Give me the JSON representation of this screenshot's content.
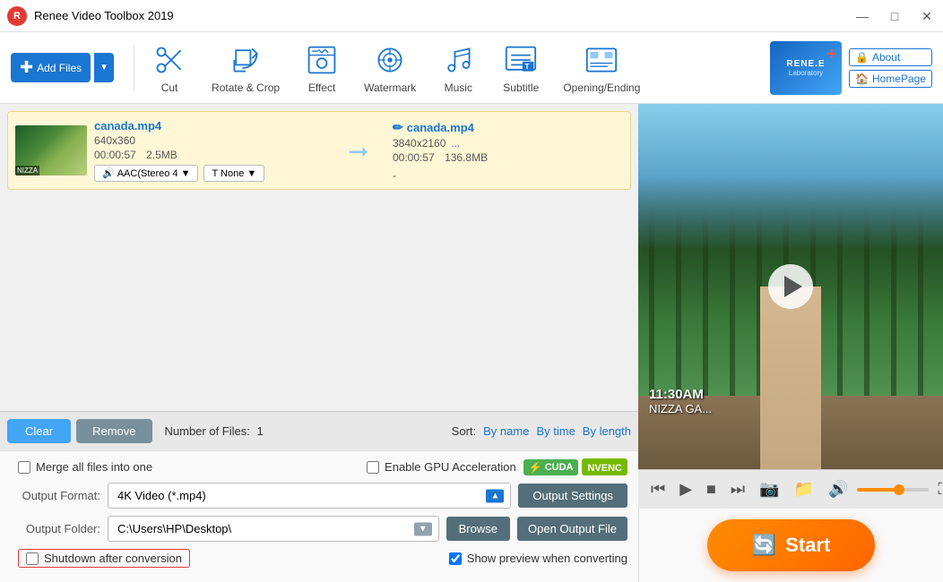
{
  "app": {
    "title": "Renee Video Toolbox 2019"
  },
  "titlebar": {
    "min_btn": "—",
    "max_btn": "□",
    "close_btn": "✕"
  },
  "toolbar": {
    "add_files": "Add Files",
    "cut": "Cut",
    "rotate_crop": "Rotate & Crop",
    "effect": "Effect",
    "watermark": "Watermark",
    "music": "Music",
    "subtitle": "Subtitle",
    "opening_ending": "Opening/Ending",
    "about": "About",
    "homepage": "HomePage",
    "brand_name": "RENE.E",
    "brand_sub": "Laboratory"
  },
  "file_item": {
    "input_name": "canada.mp4",
    "input_res": "640x360",
    "input_duration": "00:00:57",
    "input_size": "2.5MB",
    "audio_label": "AAC(Stereo 4",
    "subtitle_label": "T  None",
    "output_name": "canada.mp4",
    "output_res": "3840x2160",
    "output_more": "...",
    "output_duration": "00:00:57",
    "output_size": "136.8MB",
    "output_sub": "-"
  },
  "bottom_toolbar": {
    "clear_btn": "Clear",
    "remove_btn": "Remove",
    "file_count_label": "Number of Files:",
    "file_count": "1",
    "sort_label": "Sort:",
    "sort_name": "By name",
    "sort_time": "By time",
    "sort_length": "By length"
  },
  "player_controls": {
    "skip_back": "⏮",
    "play": "▶",
    "stop": "■",
    "skip_fwd": "⏭",
    "camera": "📷",
    "folder": "📁",
    "volume": "🔊",
    "fullscreen": "⛶"
  },
  "video_overlay": {
    "time": "11:30AM",
    "location": "NIZZA GA..."
  },
  "settings": {
    "output_format_label": "Output Format:",
    "output_format_value": "4K Video (*.mp4)",
    "output_folder_label": "Output Folder:",
    "output_folder_value": "C:\\Users\\HP\\Desktop\\",
    "output_settings_btn": "Output Settings",
    "browse_btn": "Browse",
    "open_output_btn": "Open Output File",
    "merge_label": "Merge all files into one",
    "gpu_label": "Enable GPU Acceleration",
    "cuda_badge": "CUDA",
    "nvenc_badge": "NVENC",
    "shutdown_label": "Shutdown after conversion",
    "preview_label": "Show preview when converting"
  },
  "start_btn": "Start",
  "colors": {
    "accent_blue": "#1976d2",
    "accent_orange": "#ff6600",
    "brand_red": "#e53935"
  }
}
